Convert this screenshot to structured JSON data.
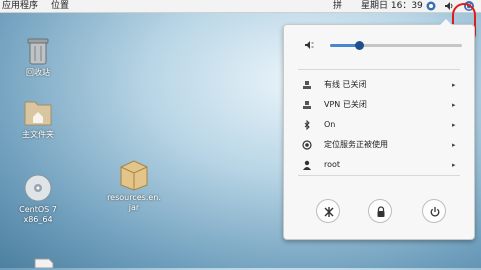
{
  "topbar": {
    "apps_menu": "应用程序",
    "places_menu": "位置",
    "input_method": "拼",
    "clock": "星期日 16：39",
    "icons": [
      "network-icon",
      "volume-icon",
      "power-icon"
    ]
  },
  "desktop": {
    "icons": [
      {
        "label": "回收站",
        "icon": "trash-icon"
      },
      {
        "label": "主文件夹",
        "icon": "home-folder-icon"
      },
      {
        "label_line1": "CentOS 7",
        "label_line2": "x86_64",
        "icon": "dvd-icon"
      },
      {
        "label_line1": "resources.en.",
        "label_line2": "jar",
        "icon": "jar-package-icon"
      },
      {
        "icon": "document-icon"
      }
    ]
  },
  "system_menu": {
    "volume_level": 0.22,
    "items": [
      {
        "label": "有线 已关闭",
        "icon": "wired-network-icon"
      },
      {
        "label": "VPN 已关闭",
        "icon": "vpn-icon"
      },
      {
        "label": "On",
        "icon": "bluetooth-icon"
      },
      {
        "label": "定位服务正被使用",
        "icon": "location-icon"
      },
      {
        "label": "root",
        "icon": "user-icon"
      }
    ],
    "submenu_arrow": "▸",
    "actions": [
      "settings-icon",
      "lock-icon",
      "power-off-icon"
    ]
  },
  "annotation": {
    "color": "#e01b1b"
  }
}
